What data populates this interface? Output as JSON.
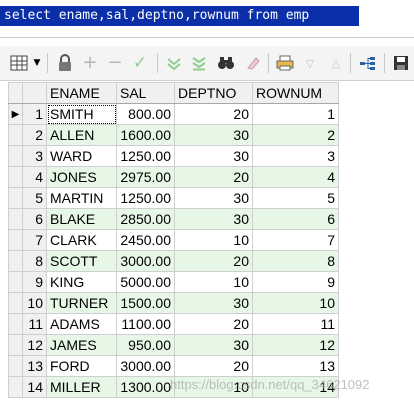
{
  "editor": {
    "sql": "select ename,sal,deptno,rownum from emp"
  },
  "toolbar": {
    "icons": [
      "grid-icon",
      "dropdown-arrow-icon",
      "lock-icon",
      "plus-icon",
      "minus-icon",
      "check-icon",
      "down-arrow-icon",
      "double-down-arrow-icon",
      "binoculars-icon",
      "eraser-icon",
      "print-icon",
      "triangle-down-icon",
      "triangle-up-icon",
      "chart-icon",
      "save-icon"
    ]
  },
  "grid": {
    "columns": [
      "ENAME",
      "SAL",
      "DEPTNO",
      "ROWNUM"
    ],
    "rows": [
      {
        "num": "1",
        "ename": "SMITH",
        "sal": "800.00",
        "deptno": "20",
        "rownum": "1"
      },
      {
        "num": "2",
        "ename": "ALLEN",
        "sal": "1600.00",
        "deptno": "30",
        "rownum": "2"
      },
      {
        "num": "3",
        "ename": "WARD",
        "sal": "1250.00",
        "deptno": "30",
        "rownum": "3"
      },
      {
        "num": "4",
        "ename": "JONES",
        "sal": "2975.00",
        "deptno": "20",
        "rownum": "4"
      },
      {
        "num": "5",
        "ename": "MARTIN",
        "sal": "1250.00",
        "deptno": "30",
        "rownum": "5"
      },
      {
        "num": "6",
        "ename": "BLAKE",
        "sal": "2850.00",
        "deptno": "30",
        "rownum": "6"
      },
      {
        "num": "7",
        "ename": "CLARK",
        "sal": "2450.00",
        "deptno": "10",
        "rownum": "7"
      },
      {
        "num": "8",
        "ename": "SCOTT",
        "sal": "3000.00",
        "deptno": "20",
        "rownum": "8"
      },
      {
        "num": "9",
        "ename": "KING",
        "sal": "5000.00",
        "deptno": "10",
        "rownum": "9"
      },
      {
        "num": "10",
        "ename": "TURNER",
        "sal": "1500.00",
        "deptno": "30",
        "rownum": "10"
      },
      {
        "num": "11",
        "ename": "ADAMS",
        "sal": "1100.00",
        "deptno": "20",
        "rownum": "11"
      },
      {
        "num": "12",
        "ename": "JAMES",
        "sal": "950.00",
        "deptno": "30",
        "rownum": "12"
      },
      {
        "num": "13",
        "ename": "FORD",
        "sal": "3000.00",
        "deptno": "20",
        "rownum": "13"
      },
      {
        "num": "14",
        "ename": "MILLER",
        "sal": "1300.00",
        "deptno": "10",
        "rownum": "14"
      }
    ],
    "current_row_marker": "▶"
  },
  "watermark": "https://blog.csdn.net/qq_34621092",
  "colors": {
    "sql_highlight": "#0a2fa8",
    "row_alt": "#e6f7e6"
  }
}
